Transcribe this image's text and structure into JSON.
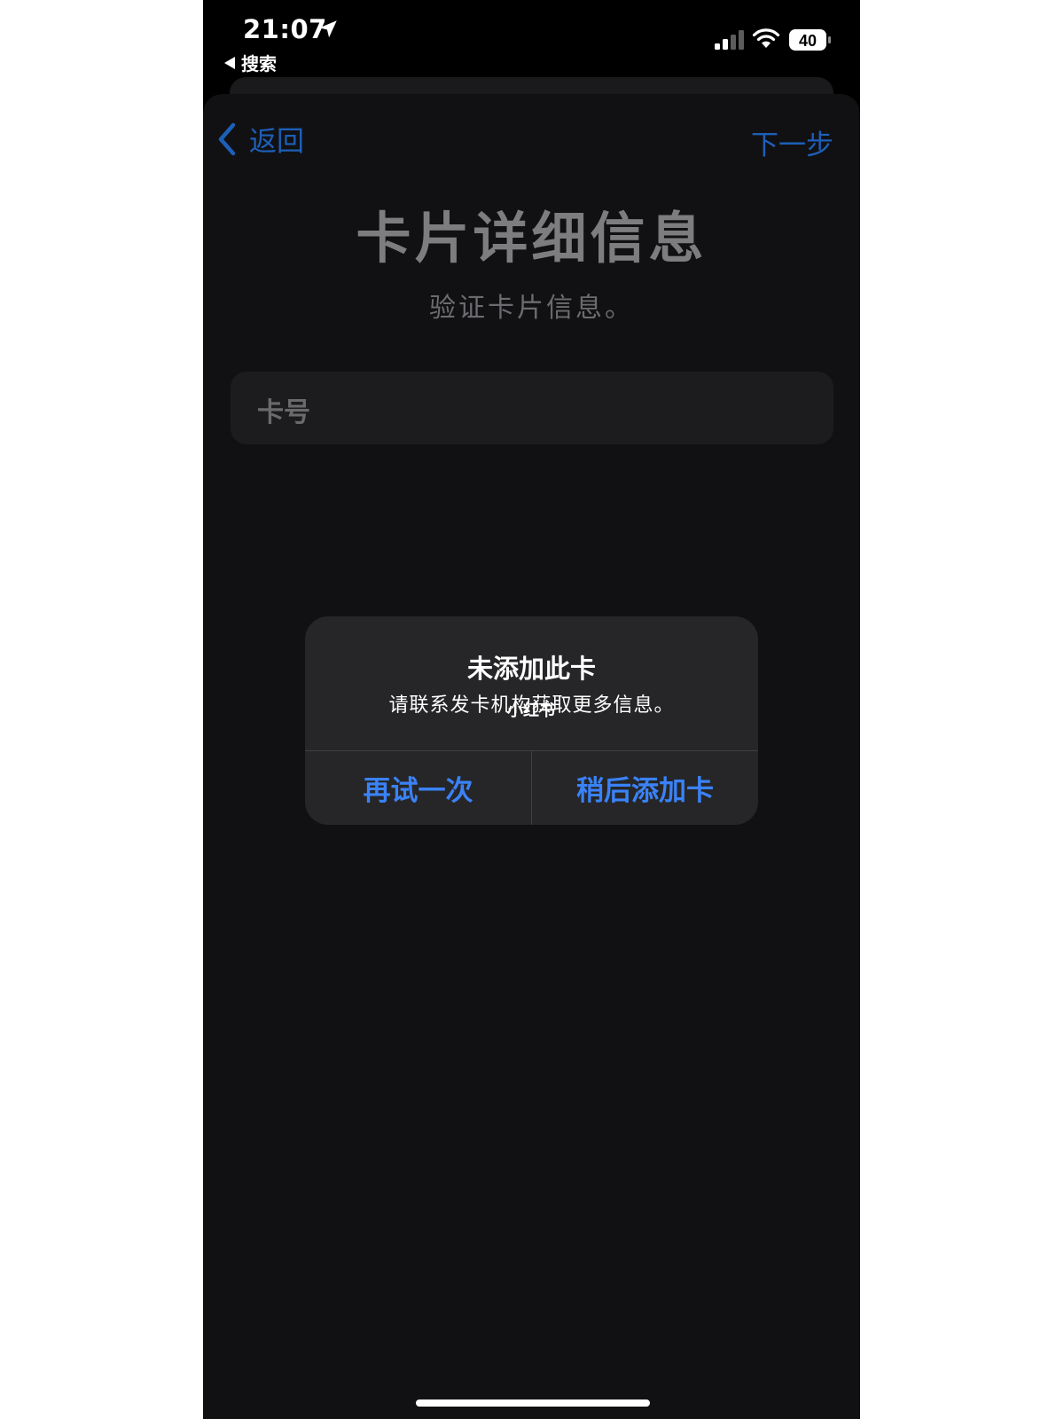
{
  "status_bar": {
    "time": "21:07",
    "back_app_label": "搜索",
    "battery_level": "40"
  },
  "nav": {
    "back_label": "返回",
    "next_label": "下一步"
  },
  "page": {
    "title": "卡片详细信息",
    "subtitle": "验证卡片信息。"
  },
  "card_field": {
    "label": "卡号"
  },
  "alert": {
    "title": "未添加此卡",
    "message": "请联系发卡机构获取更多信息。",
    "overlay_text": "小红书",
    "retry_label": "再试一次",
    "add_later_label": "稍后添加卡"
  },
  "colors": {
    "accent": "#3a82f7",
    "nav_accent": "#1d5fb8",
    "sheet_bg": "#111113",
    "alert_bg": "#262628"
  }
}
